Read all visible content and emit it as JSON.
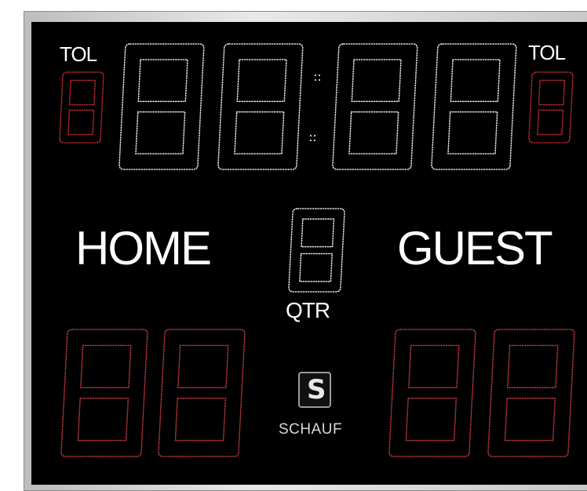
{
  "scoreboard": {
    "tol_left": "TOL",
    "tol_right": "TOL",
    "home_label": "HOME",
    "guest_label": "GUEST",
    "period_label": "QTR",
    "brand": "SCHAUF",
    "brand_logo_letter": "S"
  },
  "colors": {
    "board_background": "#000000",
    "frame": "#cfcfcf",
    "label_text": "#ffffff",
    "clock_led": "#d8dccf",
    "score_led": "#b0343c",
    "timeout_led": "#b02830"
  },
  "icons": {
    "logo": "schauf-logo-icon"
  }
}
